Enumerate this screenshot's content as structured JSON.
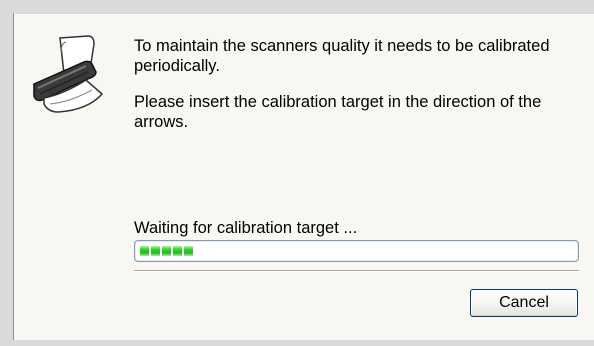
{
  "dialog": {
    "message_line1": "To maintain the scanners quality it needs to be calibrated periodically.",
    "message_line2": "Please insert the calibration target in the direction of the arrows.",
    "status_text": "Waiting for calibration target ...",
    "progress_segments_filled": 5,
    "cancel_label": "Cancel",
    "icon": "scanner-icon"
  },
  "colors": {
    "dialog_bg": "#f8f7f2",
    "progress_green": "#22bb22",
    "button_border": "#003c74",
    "progress_border": "#7f9db9"
  }
}
